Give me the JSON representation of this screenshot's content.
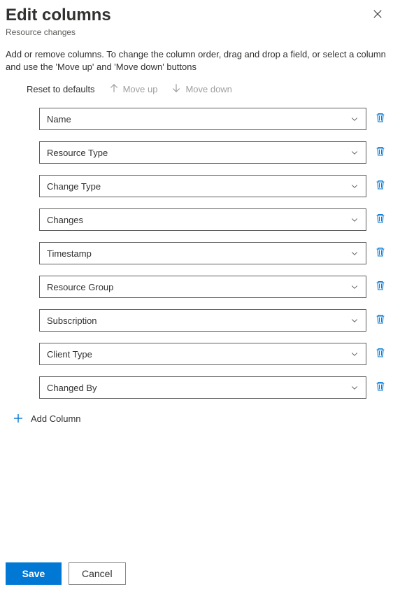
{
  "header": {
    "title": "Edit columns",
    "subtitle": "Resource changes"
  },
  "description": "Add or remove columns. To change the column order, drag and drop a field, or select a column and use the 'Move up' and 'Move down' buttons",
  "toolbar": {
    "reset_label": "Reset to defaults",
    "move_up_label": "Move up",
    "move_down_label": "Move down"
  },
  "columns": [
    {
      "label": "Name"
    },
    {
      "label": "Resource Type"
    },
    {
      "label": "Change Type"
    },
    {
      "label": "Changes"
    },
    {
      "label": "Timestamp"
    },
    {
      "label": "Resource Group"
    },
    {
      "label": "Subscription"
    },
    {
      "label": "Client Type"
    },
    {
      "label": "Changed By"
    }
  ],
  "add_column_label": "Add Column",
  "footer": {
    "save_label": "Save",
    "cancel_label": "Cancel"
  }
}
